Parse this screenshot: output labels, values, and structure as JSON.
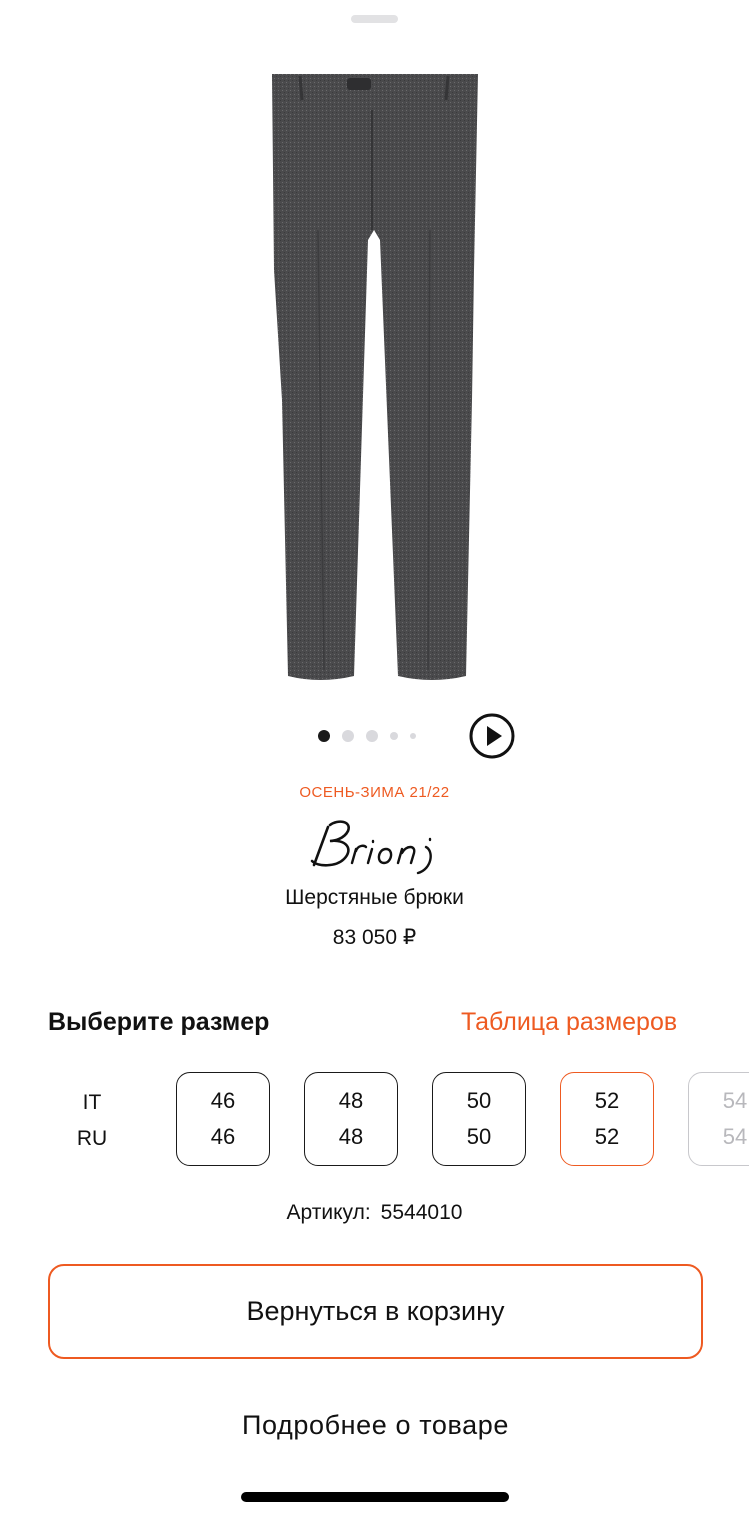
{
  "colors": {
    "accent": "#ee5a21",
    "text": "#111111",
    "disabled": "#b8b8bc"
  },
  "product": {
    "image_icon": "wool-trousers-image",
    "carousel": {
      "dot_count": 5,
      "active_index": 0
    },
    "season": "ОСЕНЬ-ЗИМА 21/22",
    "brand": "Brioni",
    "name": "Шерстяные брюки",
    "price": "83 050 ₽"
  },
  "size_picker": {
    "title": "Выберите размер",
    "size_table_link": "Таблица размеров",
    "systems": [
      "IT",
      "RU"
    ],
    "sizes": [
      {
        "it": "46",
        "ru": "46",
        "state": "available"
      },
      {
        "it": "48",
        "ru": "48",
        "state": "available"
      },
      {
        "it": "50",
        "ru": "50",
        "state": "available"
      },
      {
        "it": "52",
        "ru": "52",
        "state": "selected"
      },
      {
        "it": "54",
        "ru": "54",
        "state": "disabled"
      }
    ]
  },
  "article": {
    "label": "Артикул:",
    "value": "5544010"
  },
  "actions": {
    "primary": "Вернуться в корзину",
    "secondary": "Подробнее о товаре"
  }
}
